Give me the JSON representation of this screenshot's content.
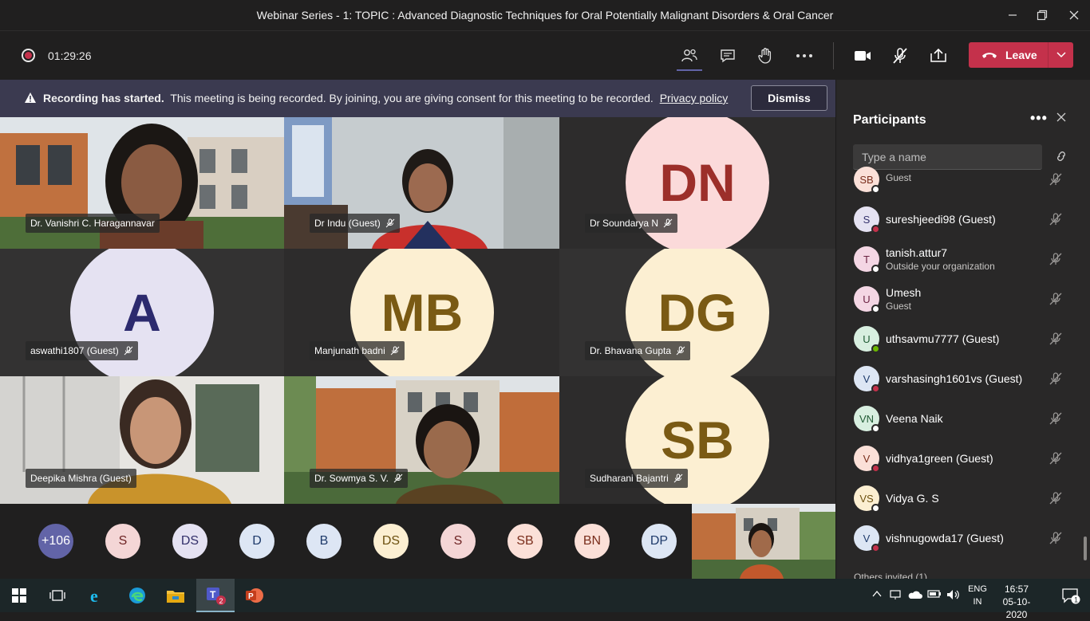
{
  "window": {
    "title": "Webinar Series - 1: TOPIC : Advanced Diagnostic Techniques for Oral Potentially Malignant Disorders & Oral Cancer",
    "controls": [
      "minimize-icon",
      "maximize-icon",
      "close-icon"
    ]
  },
  "toolbar": {
    "timer": "01:29:26",
    "buttons": [
      "people-icon",
      "chat-icon",
      "raise-hand-icon",
      "more-icon",
      "camera-icon",
      "mic-off-icon",
      "share-icon"
    ],
    "leave_label": "Leave",
    "leave_color": "#c4314b"
  },
  "banner": {
    "bold": "Recording has started.",
    "text": "This meeting is being recorded. By joining, you are giving consent for this meeting to be recorded.",
    "link": "Privacy policy",
    "dismiss": "Dismiss"
  },
  "tiles": [
    {
      "name": "Dr. Vanishri C. Haragannavar",
      "kind": "video",
      "muted": false
    },
    {
      "name": "Dr Indu (Guest)",
      "kind": "video",
      "muted": true
    },
    {
      "name": "Dr Soundarya N",
      "kind": "avatar",
      "initials": "DN",
      "muted": true,
      "bg": "#fbdada",
      "fg": "#9c2f2a"
    },
    {
      "name": "aswathi1807 (Guest)",
      "kind": "avatar",
      "initials": "A",
      "muted": true,
      "bg": "#e5e2f2",
      "fg": "#2c2a6e"
    },
    {
      "name": "Manjunath badni",
      "kind": "avatar",
      "initials": "MB",
      "muted": true,
      "bg": "#fcefd2",
      "fg": "#7a5a14"
    },
    {
      "name": "Dr. Bhavana Gupta",
      "kind": "avatar",
      "initials": "DG",
      "muted": true,
      "bg": "#fcefd2",
      "fg": "#7a5a14"
    },
    {
      "name": "Deepika Mishra (Guest)",
      "kind": "video",
      "muted": false
    },
    {
      "name": "Dr. Sowmya S. V.",
      "kind": "video",
      "muted": true
    },
    {
      "name": "Sudharani Bajantri",
      "kind": "avatar",
      "initials": "SB",
      "muted": true,
      "bg": "#fcefd2",
      "fg": "#7a5a14"
    }
  ],
  "strip": [
    {
      "initials": "+106",
      "bg": "#6264a7",
      "fg": "#ffffff"
    },
    {
      "initials": "S",
      "bg": "#f4d6d6",
      "fg": "#6d2424"
    },
    {
      "initials": "DS",
      "bg": "#e5e2f2",
      "fg": "#33306b"
    },
    {
      "initials": "D",
      "bg": "#dde6f4",
      "fg": "#1f3b6b"
    },
    {
      "initials": "B",
      "bg": "#dde6f4",
      "fg": "#1f3b6b"
    },
    {
      "initials": "DS",
      "bg": "#fcefd2",
      "fg": "#6d5110"
    },
    {
      "initials": "S",
      "bg": "#f4d6d6",
      "fg": "#6d2424"
    },
    {
      "initials": "SB",
      "bg": "#fbe0d8",
      "fg": "#7a2e1c"
    },
    {
      "initials": "BN",
      "bg": "#fbe0d8",
      "fg": "#7a2e1c"
    },
    {
      "initials": "DP",
      "bg": "#dde6f4",
      "fg": "#1f3b6b"
    }
  ],
  "panel": {
    "title": "Participants",
    "search_placeholder": "Type a name",
    "participants": [
      {
        "name": "",
        "sub": "Guest",
        "initials": "SB",
        "bg": "#fbe0d8",
        "fg": "#7a2e1c",
        "status": "#ffffff"
      },
      {
        "name": "sureshjeedi98 (Guest)",
        "sub": "",
        "initials": "S",
        "bg": "#e5e2f2",
        "fg": "#33306b",
        "status": "#c4314b"
      },
      {
        "name": "tanish.attur7",
        "sub": "Outside your organization",
        "initials": "T",
        "bg": "#f4d6e4",
        "fg": "#6d2444",
        "status": "#ffffff"
      },
      {
        "name": "Umesh",
        "sub": "Guest",
        "initials": "U",
        "bg": "#f4d6e4",
        "fg": "#6d2444",
        "status": "#ffffff"
      },
      {
        "name": "uthsavmu7777 (Guest)",
        "sub": "",
        "initials": "U",
        "bg": "#d8efe0",
        "fg": "#1f5a33",
        "status": "#6bb700"
      },
      {
        "name": "varshasingh1601vs (Guest)",
        "sub": "",
        "initials": "V",
        "bg": "#dde6f4",
        "fg": "#1f3b6b",
        "status": "#c4314b"
      },
      {
        "name": "Veena Naik",
        "sub": "",
        "initials": "VN",
        "bg": "#d8efe0",
        "fg": "#1f5a33",
        "status": "#ffffff"
      },
      {
        "name": "vidhya1green (Guest)",
        "sub": "",
        "initials": "V",
        "bg": "#fbe0d8",
        "fg": "#7a2e1c",
        "status": "#c4314b"
      },
      {
        "name": "Vidya G. S",
        "sub": "",
        "initials": "VS",
        "bg": "#fcefd2",
        "fg": "#6d5110",
        "status": "#ffffff"
      },
      {
        "name": "vishnugowda17 (Guest)",
        "sub": "",
        "initials": "V",
        "bg": "#dde6f4",
        "fg": "#1f3b6b",
        "status": "#c4314b"
      }
    ],
    "others": "Others invited (1)"
  },
  "taskbar": {
    "apps": [
      "windows-start-icon",
      "task-view-icon",
      "internet-explorer-icon",
      "edge-icon",
      "file-explorer-icon",
      "teams-icon",
      "powerpoint-icon"
    ],
    "teams_badge": "2",
    "lang_top": "ENG",
    "lang_bottom": "IN",
    "time": "16:57",
    "date": "05-10-2020",
    "notif_count": "1"
  }
}
